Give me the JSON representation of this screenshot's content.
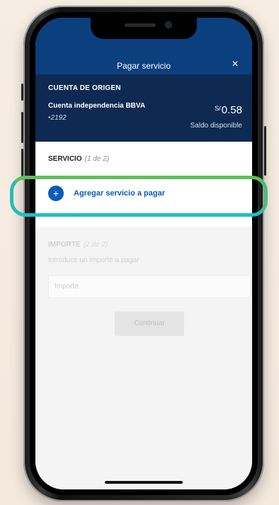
{
  "header": {
    "title": "Pagar servicio",
    "close_symbol": "×"
  },
  "origin": {
    "heading": "CUENTA DE ORIGEN",
    "account_name": "Cuenta independencia BBVA",
    "account_number": "•2192",
    "currency": "S/",
    "balance": "0.58",
    "balance_label": "Saldo disponible"
  },
  "service": {
    "title": "SERVICIO",
    "step": "(1 de 2)",
    "add_symbol": "+",
    "add_label": "Agregar servicio a pagar"
  },
  "amount": {
    "title": "IMPORTE",
    "step": "(2 de 2)",
    "hint": "Introduce un importe a pagar",
    "placeholder": "Importe"
  },
  "actions": {
    "continue_label": "Continuar"
  },
  "colors": {
    "header_bg": "#0b3f7d",
    "origin_bg": "#0e2a52",
    "accent": "#0b5cb8",
    "highlight_green": "#5ec05a",
    "highlight_cyan": "#1cc0c8"
  }
}
